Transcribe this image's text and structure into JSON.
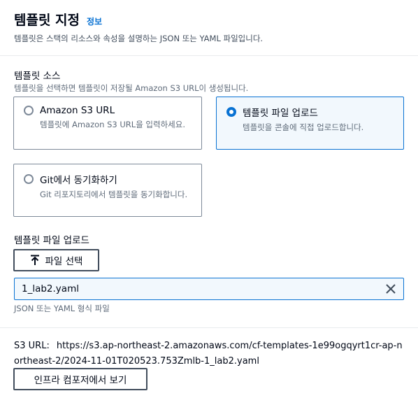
{
  "header": {
    "title": "템플릿 지정",
    "info_link": "정보",
    "description": "템플릿은 스택의 리소스와 속성을 설명하는 JSON 또는 YAML 파일입니다."
  },
  "template_source": {
    "label": "템플릿 소스",
    "description": "템플릿을 선택하면 템플릿이 저장될 Amazon S3 URL이 생성됩니다.",
    "options": [
      {
        "label": "Amazon S3 URL",
        "description": "템플릿에 Amazon S3 URL을 입력하세요.",
        "selected": false
      },
      {
        "label": "템플릿 파일 업로드",
        "description": "템플릿을 콘솔에 직접 업로드합니다.",
        "selected": true
      },
      {
        "label": "Git에서 동기화하기",
        "description": "Git 리포지토리에서 템플릿을 동기화합니다.",
        "selected": false
      }
    ]
  },
  "upload": {
    "label": "템플릿 파일 업로드",
    "choose_button": "파일 선택",
    "file_name": "1_lab2.yaml",
    "hint": "JSON 또는 YAML 형식 파일"
  },
  "s3": {
    "label": "S3 URL:",
    "url": "https://s3.ap-northeast-2.amazonaws.com/cf-templates-1e99ogqyrt1cr-ap-northeast-2/2024-11-01T020523.753Zmlb-1_lab2.yaml"
  },
  "composer_button": "인프라 컴포저에서 보기",
  "colors": {
    "accent": "#0972d3",
    "selected_bg": "#f2f8fd",
    "border": "#7d8998"
  }
}
